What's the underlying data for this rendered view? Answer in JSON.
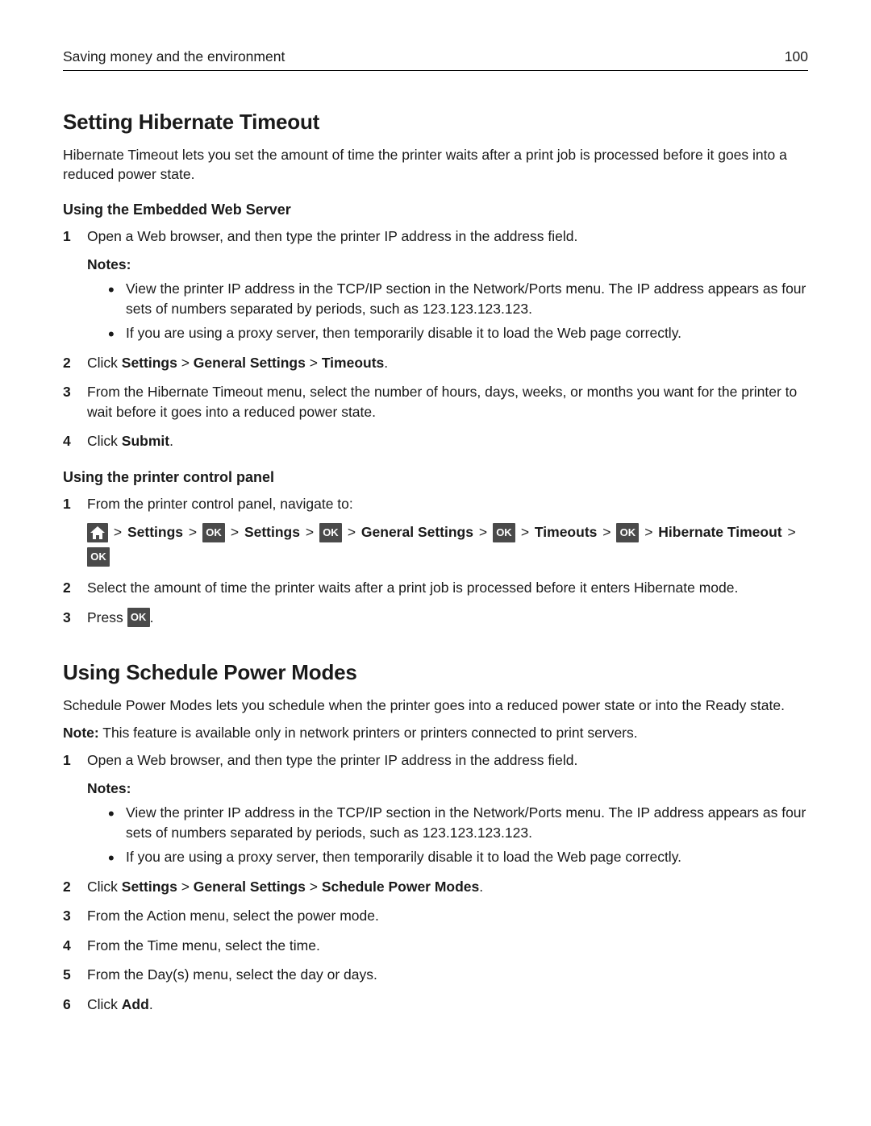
{
  "header": {
    "title": "Saving money and the environment",
    "page": "100"
  },
  "s1": {
    "heading": "Setting Hibernate Timeout",
    "intro": "Hibernate Timeout lets you set the amount of time the printer waits after a print job is processed before it goes into a reduced power state.",
    "sub1": "Using the Embedded Web Server",
    "step1": "Open a Web browser, and then type the printer IP address in the address field.",
    "notes": "Notes:",
    "note1": "View the printer IP address in the TCP/IP section in the Network/Ports menu. The IP address appears as four sets of numbers separated by periods, such as 123.123.123.123.",
    "note2": "If you are using a proxy server, then temporarily disable it to load the Web page correctly.",
    "step2_pre": "Click ",
    "step2_b1": "Settings",
    "step2_b2": "General Settings",
    "step2_b3": "Timeouts",
    "step3": "From the Hibernate Timeout menu, select the number of hours, days, weeks, or months you want for the printer to wait before it goes into a reduced power state.",
    "step4_pre": "Click ",
    "step4_b": "Submit",
    "sub2": "Using the printer control panel",
    "cp_step1": "From the printer control panel, navigate to:",
    "nav1": "Settings",
    "nav2": "Settings",
    "nav3": "General Settings",
    "nav4": "Timeouts",
    "nav5": "Hibernate Timeout",
    "ok": "OK",
    "cp_step2": "Select the amount of time the printer waits after a print job is processed before it enters Hibernate mode.",
    "cp_step3_pre": "Press "
  },
  "s2": {
    "heading": "Using Schedule Power Modes",
    "intro": "Schedule Power Modes lets you schedule when the printer goes into a reduced power state or into the Ready state.",
    "note_pre": "Note:",
    "note_body": " This feature is available only in network printers or printers connected to print servers.",
    "step1": "Open a Web browser, and then type the printer IP address in the address field.",
    "notes": "Notes:",
    "note1": "View the printer IP address in the TCP/IP section in the Network/Ports menu. The IP address appears as four sets of numbers separated by periods, such as 123.123.123.123.",
    "note2": "If you are using a proxy server, then temporarily disable it to load the Web page correctly.",
    "step2_pre": "Click ",
    "step2_b1": "Settings",
    "step2_b2": "General Settings",
    "step2_b3": "Schedule Power Modes",
    "step3": "From the Action menu, select the power mode.",
    "step4": "From the Time menu, select the time.",
    "step5": "From the Day(s) menu, select the day or days.",
    "step6_pre": "Click ",
    "step6_b": "Add"
  }
}
